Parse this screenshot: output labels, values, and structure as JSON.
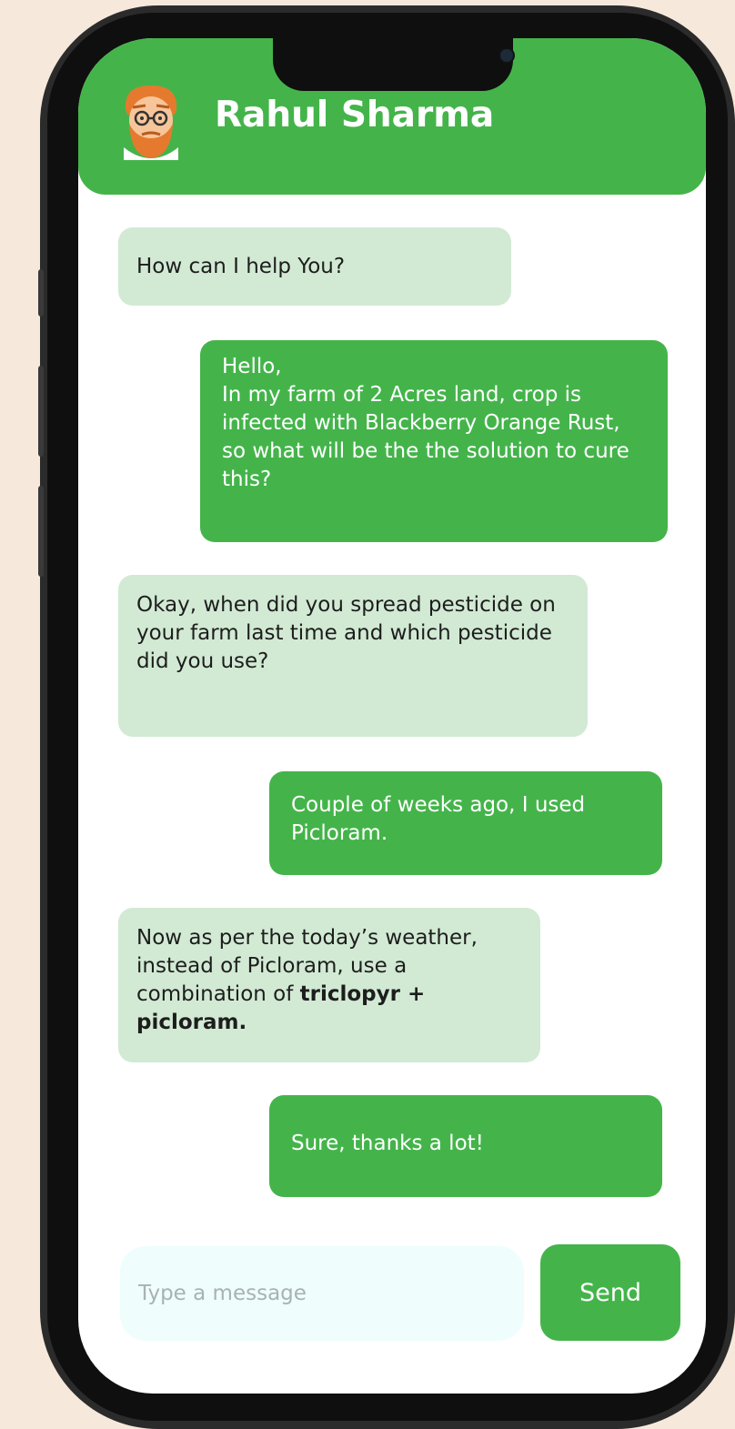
{
  "header": {
    "contact_name": "Rahul Sharma"
  },
  "messages": [
    {
      "sender": "contact",
      "text": "How can I help You?"
    },
    {
      "sender": "user",
      "text": "Hello,\nIn my farm of 2 Acres land, crop is infected with Blackberry Orange Rust, so what will be the the solution to cure this?"
    },
    {
      "sender": "contact",
      "text": "Okay, when did you spread pesticide on your farm last time and which pesticide did you use?"
    },
    {
      "sender": "user",
      "text": "Couple of weeks ago, I used Picloram."
    },
    {
      "sender": "contact",
      "text": "Now as per the today’s weather, instead of Picloram, use a combination of ",
      "bold_text": "triclopyr + picloram."
    },
    {
      "sender": "user",
      "text": "Sure, thanks a lot!"
    }
  ],
  "composer": {
    "placeholder": "Type a message",
    "send_label": "Send"
  },
  "colors": {
    "accent_green": "#44b44a",
    "received_bubble": "#d2ead4",
    "input_background": "#effdfd",
    "page_background": "#f6e9dc"
  }
}
